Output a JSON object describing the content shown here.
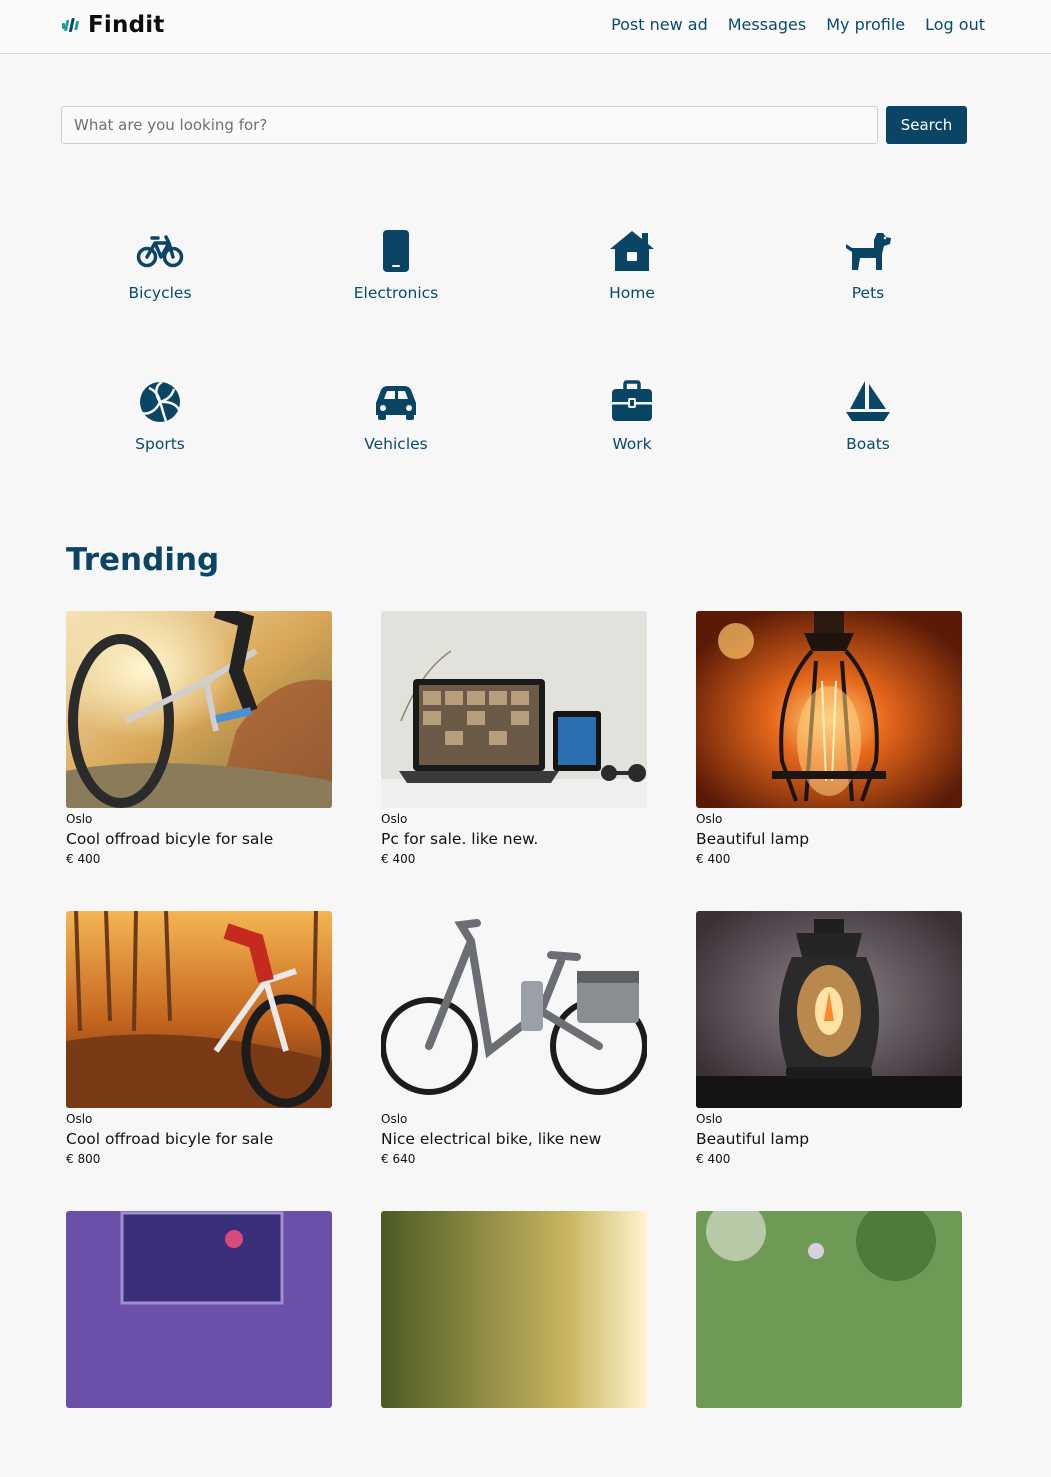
{
  "header": {
    "brand": "Findit",
    "nav": [
      {
        "label": "Post new ad"
      },
      {
        "label": "Messages"
      },
      {
        "label": "My profile"
      },
      {
        "label": "Log out"
      }
    ]
  },
  "search": {
    "placeholder": "What are you looking for?",
    "button_label": "Search"
  },
  "categories": [
    {
      "label": "Bicycles",
      "icon": "bicycle-icon"
    },
    {
      "label": "Electronics",
      "icon": "phone-icon"
    },
    {
      "label": "Home",
      "icon": "house-icon"
    },
    {
      "label": "Pets",
      "icon": "dog-icon"
    },
    {
      "label": "Sports",
      "icon": "volleyball-icon"
    },
    {
      "label": "Vehicles",
      "icon": "car-icon"
    },
    {
      "label": "Work",
      "icon": "briefcase-icon"
    },
    {
      "label": "Boats",
      "icon": "sailboat-icon"
    }
  ],
  "trending": {
    "title": "Trending",
    "listings": [
      {
        "location": "Oslo",
        "title": "Cool offroad bicyle for sale",
        "price": "€ 400"
      },
      {
        "location": "Oslo",
        "title": "Pc for sale. like new.",
        "price": "€ 400"
      },
      {
        "location": "Oslo",
        "title": "Beautiful lamp",
        "price": "€ 400"
      },
      {
        "location": "Oslo",
        "title": "Cool offroad bicyle for sale",
        "price": "€ 800"
      },
      {
        "location": "Oslo",
        "title": "Nice electrical bike, like new",
        "price": "€ 640"
      },
      {
        "location": "Oslo",
        "title": "Beautiful lamp",
        "price": "€ 400"
      },
      {
        "location": "",
        "title": "",
        "price": ""
      },
      {
        "location": "",
        "title": "",
        "price": ""
      },
      {
        "location": "",
        "title": "",
        "price": ""
      }
    ]
  },
  "colors": {
    "primary": "#0b4566",
    "accent": "#16a0a0",
    "background": "#f7f7f7"
  }
}
